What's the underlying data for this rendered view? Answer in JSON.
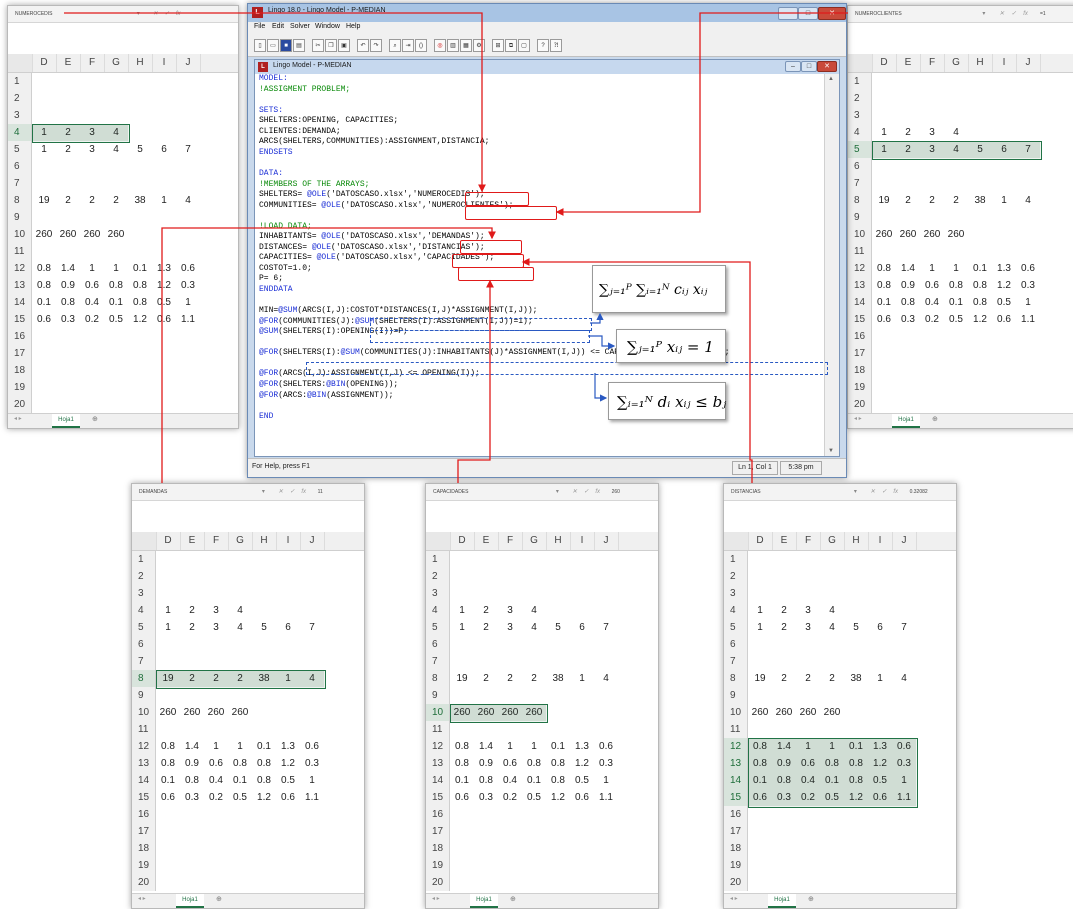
{
  "lingo": {
    "title": "Lingo 18.0 - Lingo Model - P-MEDIAN",
    "menus": [
      "File",
      "Edit",
      "Solver",
      "Window",
      "Help"
    ],
    "doc_title": "Lingo Model - P-MEDIAN",
    "status_left": "For Help, press F1",
    "status_pos": "Ln 1, Col 1",
    "status_time": "5:38 pm",
    "code": [
      {
        "t": "MODEL:",
        "c": "blue"
      },
      {
        "t": "!ASSIGMENT PROBLEM;",
        "c": "green"
      },
      {
        "t": "",
        "c": ""
      },
      {
        "t": "SETS:",
        "c": "blue"
      },
      {
        "t": "SHELTERS:OPENING, CAPACITIES;",
        "c": ""
      },
      {
        "t": "CLIENTES:DEMANDA;",
        "c": ""
      },
      {
        "t": "ARCS(SHELTERS,COMMUNITIES):ASSIGNMENT,DISTANCIA;",
        "c": ""
      },
      {
        "t": "ENDSETS",
        "c": "blue"
      },
      {
        "t": "",
        "c": ""
      },
      {
        "t": "DATA:",
        "c": "blue"
      },
      {
        "t": "!MEMBERS OF THE ARRAYS;",
        "c": "green"
      },
      {
        "t": "SHELTERS= @OLE('DATOSCASO.xlsx','NUMEROCEDIS');",
        "c": "",
        "ole": true
      },
      {
        "t": "COMMUNITIES= @OLE('DATOSCASO.xlsx','NUMEROCLIENTES');",
        "c": "",
        "ole": true
      },
      {
        "t": "",
        "c": ""
      },
      {
        "t": "!LOAD DATA;",
        "c": "green"
      },
      {
        "t": "INHABITANTS= @OLE('DATOSCASO.xlsx','DEMANDAS');",
        "c": "",
        "ole": true
      },
      {
        "t": "DISTANCES= @OLE('DATOSCASO.xlsx','DISTANCIAS');",
        "c": "",
        "ole": true
      },
      {
        "t": "CAPACITIES= @OLE('DATOSCASO.xlsx','CAPACIDADES');",
        "c": "",
        "ole": true
      },
      {
        "t": "COSTOT=1.0;",
        "c": ""
      },
      {
        "t": "P= 6;",
        "c": ""
      },
      {
        "t": "ENDDATA",
        "c": "blue"
      },
      {
        "t": "",
        "c": ""
      },
      {
        "t": "MIN=@SUM(ARCS(I,J):COSTOT*DISTANCES(I,J)*ASSIGNMENT(I,J));",
        "c": "",
        "fn": true
      },
      {
        "t": "@FOR(COMMUNITIES(J):@SUM(SHELTERS(I):ASSIGNMENT(I,J))=1);",
        "c": "",
        "fn": true
      },
      {
        "t": "@SUM(SHELTERS(I):OPENING(I))=P;",
        "c": "",
        "fn": true
      },
      {
        "t": "",
        "c": ""
      },
      {
        "t": "@FOR(SHELTERS(I):@SUM(COMMUNITIES(J):INHABITANTS(J)*ASSIGNMENT(I,J)) <= CAPACITIES(I)*OPENING(I));",
        "c": "",
        "fn": true
      },
      {
        "t": "",
        "c": ""
      },
      {
        "t": "@FOR(ARCS(I,J):ASSIGNMENT(I,J) <= OPENING(I));",
        "c": "",
        "fn": true
      },
      {
        "t": "@FOR(SHELTERS:@BIN(OPENING));",
        "c": "",
        "fn": true
      },
      {
        "t": "@FOR(ARCS:@BIN(ASSIGNMENT));",
        "c": "",
        "fn": true
      },
      {
        "t": "",
        "c": ""
      },
      {
        "t": "END",
        "c": "blue"
      }
    ]
  },
  "formulas": {
    "objective": "∑ⱼ₌₁ᴾ ∑ᵢ₌₁ᴺ cᵢⱼ xᵢⱼ",
    "assignment": "∑ⱼ₌₁ᴾ xᵢⱼ = 1",
    "capacity": "∑ᵢ₌₁ᴺ dᵢ xᵢⱼ ≤ bⱼ"
  },
  "sheet": {
    "columns": [
      "D",
      "E",
      "F",
      "G",
      "H",
      "I",
      "J"
    ],
    "row_numbers": [
      "1",
      "2",
      "3",
      "4",
      "5",
      "6",
      "7",
      "8",
      "9",
      "10",
      "11",
      "12",
      "13",
      "14",
      "15",
      "16",
      "17",
      "18",
      "19",
      "20"
    ],
    "rows": {
      "4": [
        "1",
        "2",
        "3",
        "4",
        "",
        "",
        ""
      ],
      "5": [
        "1",
        "2",
        "3",
        "4",
        "5",
        "6",
        "7"
      ],
      "8": [
        "19",
        "2",
        "2",
        "2",
        "38",
        "1",
        "4"
      ],
      "10": [
        "260",
        "260",
        "260",
        "260",
        "",
        "",
        ""
      ],
      "12": [
        "0.8",
        "1.4",
        "1",
        "1",
        "0.1",
        "1.3",
        "0.6"
      ],
      "13": [
        "0.8",
        "0.9",
        "0.6",
        "0.8",
        "0.8",
        "1.2",
        "0.3"
      ],
      "14": [
        "0.1",
        "0.8",
        "0.4",
        "0.1",
        "0.8",
        "0.5",
        "1"
      ],
      "15": [
        "0.6",
        "0.3",
        "0.2",
        "0.5",
        "1.2",
        "0.6",
        "1.1"
      ]
    },
    "tab": "Hoja1",
    "add": "⊕"
  },
  "panels": [
    {
      "id": "numerocedis",
      "name": "NUMEROCEDIS",
      "fval": "",
      "sel": [
        4
      ]
    },
    {
      "id": "numeroclientes",
      "name": "NUMEROCLIENTES",
      "fval": "=1",
      "sel": [
        5
      ]
    },
    {
      "id": "demandas",
      "name": "DEMANDAS",
      "fval": "11",
      "sel": [
        8
      ]
    },
    {
      "id": "capacidades",
      "name": "CAPACIDADES",
      "fval": "260",
      "sel": [
        10
      ]
    },
    {
      "id": "distancias",
      "name": "DISTANCIAS",
      "fval": "0.32082",
      "sel": [
        12,
        13,
        14,
        15
      ]
    }
  ]
}
